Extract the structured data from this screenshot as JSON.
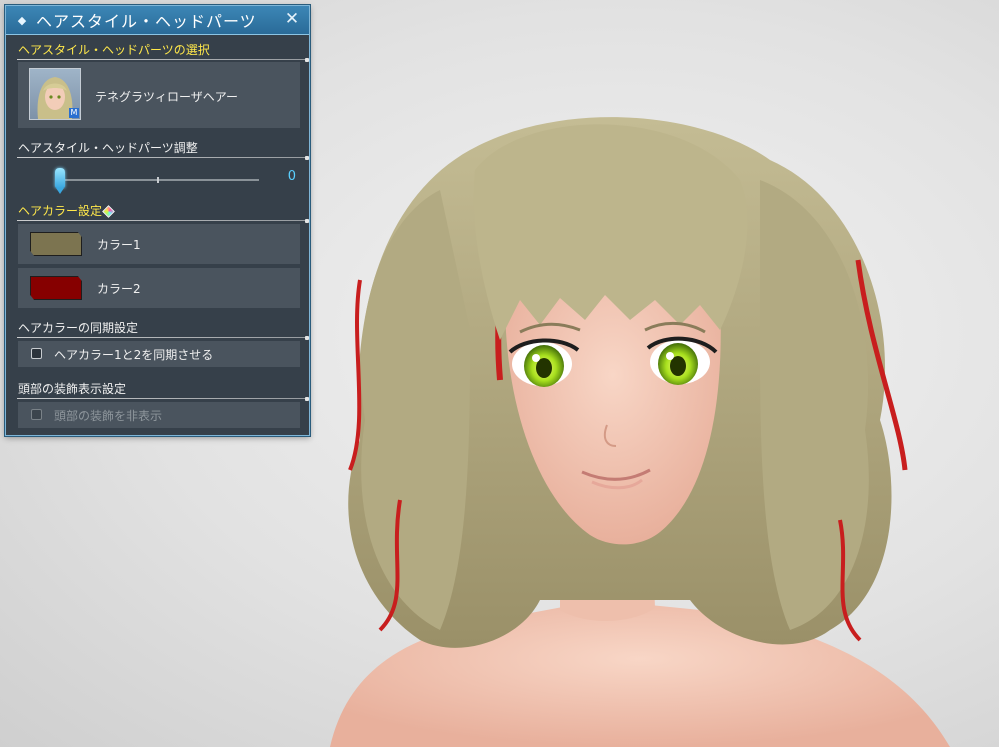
{
  "window": {
    "title": "ヘアスタイル・ヘッドパーツ",
    "close_label": "✕",
    "title_icon": "◆"
  },
  "sections": {
    "select": {
      "title": "ヘアスタイル・ヘッドパーツの選択",
      "item_name": "テネグラツィローザヘアー",
      "badge": "M"
    },
    "adjust": {
      "title": "ヘアスタイル・ヘッドパーツ調整",
      "value": "0",
      "level_fraction": 0
    },
    "color": {
      "title": "ヘアカラー設定",
      "color1": {
        "label": "カラー1",
        "hex": "#7c7450"
      },
      "color2": {
        "label": "カラー2",
        "hex": "#860000"
      }
    },
    "sync": {
      "title": "ヘアカラーの同期設定",
      "checkbox_label": "ヘアカラー1と2を同期させる",
      "checked": false
    },
    "head_deco": {
      "title": "頭部の装飾表示設定",
      "checkbox_label": "頭部の装飾を非表示",
      "checked": false,
      "enabled": false
    }
  },
  "colors": {
    "panel_bg": "#36404a",
    "row_bg": "#4a545e",
    "accent": "#4ec4ff",
    "highlight_title": "#ffe84a",
    "hair": "#b4ac84",
    "hair_streak": "#c81e1e",
    "eye": "#a8e01e",
    "skin": "#f2c6b4"
  }
}
